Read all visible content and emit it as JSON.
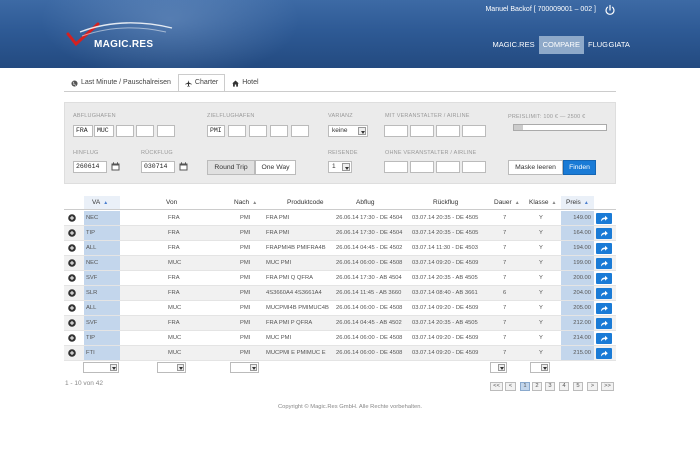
{
  "header": {
    "logo_text": "MAGIC.RES",
    "user": "Manuel Backof [ 700009001 – 002 ]",
    "nav": [
      "MAGIC.RES",
      "COMPARE",
      "FLUG",
      "GIATA"
    ],
    "active_nav": "COMPARE"
  },
  "tabs": [
    {
      "label": "Last Minute / Pauschalreisen",
      "icon": "globe-icon"
    },
    {
      "label": "Charter",
      "icon": "plane-icon",
      "active": true
    },
    {
      "label": "Hotel",
      "icon": "home-icon"
    }
  ],
  "search": {
    "abflughafen_label": "ABFLUGHAFEN",
    "abflughafen_values": [
      "FRA",
      "MUC"
    ],
    "zielflughafen_label": "ZIELFLUGHAFEN",
    "zielflughafen_values": [
      "PMI"
    ],
    "varianz_label": "VARIANZ",
    "varianz_value": "keine",
    "mit_veranstalter_label": "MIT VERANSTALTER / AIRLINE",
    "preislimit_label": "PREISLIMIT: 100 € — 2500 €",
    "hinflug_label": "HINFLUG",
    "hinflug_value": "260614",
    "rueckflug_label": "RÜCKFLUG",
    "rueckflug_value": "030714",
    "round_trip": "Round Trip",
    "one_way": "One Way",
    "reisende_label": "REISENDE",
    "reisende_value": "1",
    "ohne_veranstalter_label": "OHNE VERANSTALTER / AIRLINE",
    "clear_button": "Maske leeren",
    "find_button": "Finden"
  },
  "table": {
    "headers": {
      "va": "VA",
      "von": "Von",
      "nach": "Nach",
      "produktcode": "Produktcode",
      "abflug": "Abflug",
      "rueckflug": "Rückflug",
      "dauer": "Dauer",
      "klasse": "Klasse",
      "preis": "Preis"
    },
    "rows": [
      {
        "va": "NEC",
        "von": "FRA",
        "nach": "PMI",
        "produktcode": "FRA PMI",
        "abflug": "26.06.14 17:30 - DE 4504",
        "rueckflug": "03.07.14 20:35 - DE 4505",
        "dauer": "7",
        "klasse": "Y",
        "preis": "149.00"
      },
      {
        "va": "TIP",
        "von": "FRA",
        "nach": "PMI",
        "produktcode": "FRA PMI",
        "abflug": "26.06.14 17:30 - DE 4504",
        "rueckflug": "03.07.14 20:35 - DE 4505",
        "dauer": "7",
        "klasse": "Y",
        "preis": "164.00"
      },
      {
        "va": "ALL",
        "von": "FRA",
        "nach": "PMI",
        "produktcode": "FRAPMI4B PMIFRA4B",
        "abflug": "26.06.14 04:45 - DE 4502",
        "rueckflug": "03.07.14 11:30 - DE 4503",
        "dauer": "7",
        "klasse": "Y",
        "preis": "194.00"
      },
      {
        "va": "NEC",
        "von": "MUC",
        "nach": "PMI",
        "produktcode": "MUC PMI",
        "abflug": "26.06.14 06:00 - DE 4508",
        "rueckflug": "03.07.14 09:20 - DE 4509",
        "dauer": "7",
        "klasse": "Y",
        "preis": "199.00"
      },
      {
        "va": "SVF",
        "von": "FRA",
        "nach": "PMI",
        "produktcode": "FRA PMI Q QFRA",
        "abflug": "26.06.14 17:30 - AB 4504",
        "rueckflug": "03.07.14 20:35 - AB 4505",
        "dauer": "7",
        "klasse": "Y",
        "preis": "200.00"
      },
      {
        "va": "SLR",
        "von": "FRA",
        "nach": "PMI",
        "produktcode": "4S3660A4 4S3661A4",
        "abflug": "26.06.14 11:45 - AB 3660",
        "rueckflug": "03.07.14 08:40 - AB 3661",
        "dauer": "6",
        "klasse": "Y",
        "preis": "204.00"
      },
      {
        "va": "ALL",
        "von": "MUC",
        "nach": "PMI",
        "produktcode": "MUCPMI4B PMIMUC4B",
        "abflug": "26.06.14 06:00 - DE 4508",
        "rueckflug": "03.07.14 09:20 - DE 4509",
        "dauer": "7",
        "klasse": "Y",
        "preis": "205.00"
      },
      {
        "va": "SVF",
        "von": "FRA",
        "nach": "PMI",
        "produktcode": "FRA PMI P QFRA",
        "abflug": "26.06.14 04:45 - AB 4502",
        "rueckflug": "03.07.14 20:35 - AB 4505",
        "dauer": "7",
        "klasse": "Y",
        "preis": "212.00"
      },
      {
        "va": "TIP",
        "von": "MUC",
        "nach": "PMI",
        "produktcode": "MUC PMI",
        "abflug": "26.06.14 06:00 - DE 4508",
        "rueckflug": "03.07.14 09:20 - DE 4509",
        "dauer": "7",
        "klasse": "Y",
        "preis": "214.00"
      },
      {
        "va": "FTI",
        "von": "MUC",
        "nach": "PMI",
        "produktcode": "MUCPMI E PMIMUC E",
        "abflug": "26.06.14 06:00 - DE 4508",
        "rueckflug": "03.07.14 09:20 - DE 4509",
        "dauer": "7",
        "klasse": "Y",
        "preis": "215.00"
      }
    ]
  },
  "pagination": {
    "count_text": "1 - 10 von 42",
    "first": "<<",
    "prev": "<",
    "pages": [
      "1",
      "2",
      "3",
      "4",
      "5"
    ],
    "active_page": "1",
    "next": ">",
    "last": ">>"
  },
  "footer": {
    "copyright": "Copyright © Magic.Res GmbH. Alle Rechte vorbehalten."
  },
  "colors": {
    "header_blue": "#2e5a95",
    "accent_blue": "#1a7bd6",
    "highlight_col": "#c3d6ec",
    "logo_red": "#d42020"
  }
}
